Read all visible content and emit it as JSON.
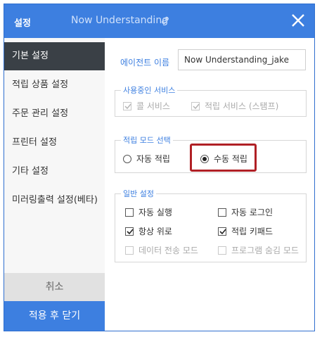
{
  "titlebar": {
    "title": "설정",
    "subtitle": "Now Understanding",
    "link_icon": "link-icon",
    "close_icon": "close-icon"
  },
  "sidebar": {
    "items": [
      {
        "label": "기본 설정",
        "active": true
      },
      {
        "label": "적립 상품 설정"
      },
      {
        "label": "주문 관리 설정"
      },
      {
        "label": "프린터 설정"
      },
      {
        "label": "기타 설정"
      },
      {
        "label": "미러링출력 설정(베타)"
      }
    ],
    "cancel_label": "취소",
    "apply_label": "적용 후 닫기"
  },
  "agent": {
    "label": "에이전트 이름",
    "value": "Now Understanding_jake"
  },
  "services": {
    "legend": "사용중인 서비스",
    "items": [
      {
        "label": "콜 서비스",
        "checked": true,
        "disabled": true
      },
      {
        "label": "적립 서비스 (스탬프)",
        "checked": true,
        "disabled": true
      }
    ]
  },
  "mode": {
    "legend": "적립 모드 선택",
    "options": [
      {
        "label": "자동 적립",
        "selected": false
      },
      {
        "label": "수동 적립",
        "selected": true
      }
    ]
  },
  "general": {
    "legend": "일반 설정",
    "items": [
      {
        "label": "자동 실행",
        "checked": false,
        "disabled": false
      },
      {
        "label": "자동 로그인",
        "checked": false,
        "disabled": false
      },
      {
        "label": "항상 위로",
        "checked": true,
        "disabled": false
      },
      {
        "label": "적립 키패드",
        "checked": true,
        "disabled": false
      },
      {
        "label": "데이터 전송 모드",
        "checked": false,
        "disabled": true
      },
      {
        "label": "프로그램 숨김 모드",
        "checked": false,
        "disabled": true
      }
    ]
  },
  "colors": {
    "accent": "#3d7fe0",
    "sidebar_active": "#3a4046",
    "highlight": "#b02025"
  }
}
